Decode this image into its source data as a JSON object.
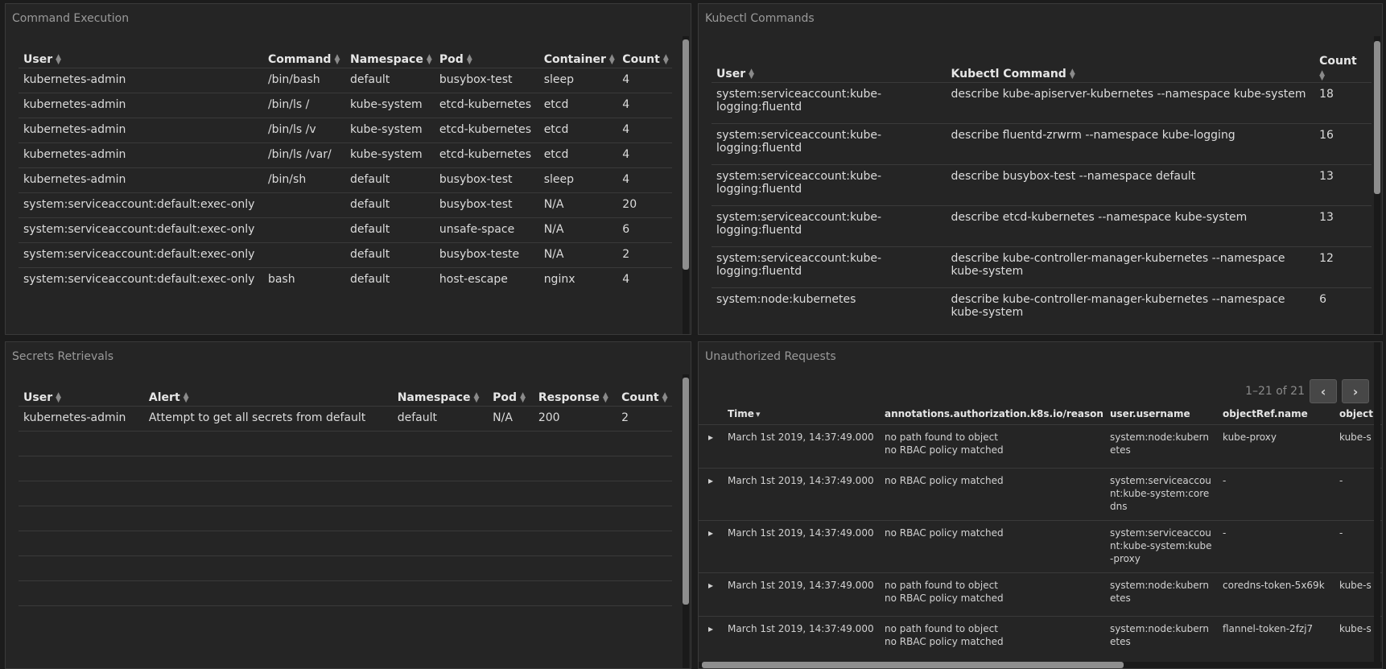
{
  "sort_glyphs": {
    "up": "▲",
    "down": "▼"
  },
  "panels": {
    "cmd": {
      "title": "Command Execution",
      "headers": [
        "User",
        "Command",
        "Namespace",
        "Pod",
        "Container",
        "Count"
      ],
      "rows": [
        [
          "kubernetes-admin",
          "/bin/bash",
          "default",
          "busybox-test",
          "sleep",
          "4"
        ],
        [
          "kubernetes-admin",
          "/bin/ls /",
          "kube-system",
          "etcd-kubernetes",
          "etcd",
          "4"
        ],
        [
          "kubernetes-admin",
          "/bin/ls /v",
          "kube-system",
          "etcd-kubernetes",
          "etcd",
          "4"
        ],
        [
          "kubernetes-admin",
          "/bin/ls /var/",
          "kube-system",
          "etcd-kubernetes",
          "etcd",
          "4"
        ],
        [
          "kubernetes-admin",
          "/bin/sh",
          "default",
          "busybox-test",
          "sleep",
          "4"
        ],
        [
          "system:serviceaccount:default:exec-only",
          "",
          "default",
          "busybox-test",
          "N/A",
          "20"
        ],
        [
          "system:serviceaccount:default:exec-only",
          "",
          "default",
          "unsafe-space",
          "N/A",
          "6"
        ],
        [
          "system:serviceaccount:default:exec-only",
          "",
          "default",
          "busybox-teste",
          "N/A",
          "2"
        ],
        [
          "system:serviceaccount:default:exec-only",
          "bash",
          "default",
          "host-escape",
          "nginx",
          "4"
        ]
      ]
    },
    "kubectl": {
      "title": "Kubectl Commands",
      "headers": [
        "User",
        "Kubectl Command",
        "Count"
      ],
      "rows": [
        [
          "system:serviceaccount:kube-logging:fluentd",
          "describe kube-apiserver-kubernetes --namespace kube-system",
          "18"
        ],
        [
          "system:serviceaccount:kube-logging:fluentd",
          "describe fluentd-zrwrm --namespace kube-logging",
          "16"
        ],
        [
          "system:serviceaccount:kube-logging:fluentd",
          "describe busybox-test --namespace default",
          "13"
        ],
        [
          "system:serviceaccount:kube-logging:fluentd",
          "describe etcd-kubernetes --namespace kube-system",
          "13"
        ],
        [
          "system:serviceaccount:kube-logging:fluentd",
          "describe kube-controller-manager-kubernetes --namespace kube-system",
          "12"
        ],
        [
          "system:node:kubernetes",
          "describe kube-controller-manager-kubernetes --namespace kube-system",
          "6"
        ]
      ]
    },
    "secrets": {
      "title": "Secrets Retrievals",
      "headers": [
        "User",
        "Alert",
        "Namespace",
        "Pod",
        "Response",
        "Count"
      ],
      "rows": [
        [
          "kubernetes-admin",
          "Attempt to get all secrets from default",
          "default",
          "N/A",
          "200",
          "2"
        ]
      ]
    },
    "unauth": {
      "title": "Unauthorized Requests",
      "pagination": "1–21 of 21",
      "prev_icon": "‹",
      "next_icon": "›",
      "headers": [
        "Time",
        "annotations.authorization.k8s.io/reason",
        "user.username",
        "objectRef.name",
        "object"
      ],
      "expand_glyph": "▸",
      "sort_desc_glyph": "▾",
      "rows": [
        [
          "March 1st 2019, 14:37:49.000",
          "no path found to object\nno RBAC policy matched",
          "system:node:kubernetes",
          "kube-proxy",
          "kube-s"
        ],
        [
          "March 1st 2019, 14:37:49.000",
          "no RBAC policy matched",
          "system:serviceaccount:kube-system:coredns",
          "-",
          "-"
        ],
        [
          "March 1st 2019, 14:37:49.000",
          "no RBAC policy matched",
          "system:serviceaccount:kube-system:kube-proxy",
          "-",
          "-"
        ],
        [
          "March 1st 2019, 14:37:49.000",
          "no path found to object\nno RBAC policy matched",
          "system:node:kubernetes",
          "coredns-token-5x69k",
          "kube-s"
        ],
        [
          "March 1st 2019, 14:37:49.000",
          "no path found to object\nno RBAC policy matched",
          "system:node:kubernetes",
          "flannel-token-2fzj7",
          "kube-s"
        ]
      ]
    }
  }
}
